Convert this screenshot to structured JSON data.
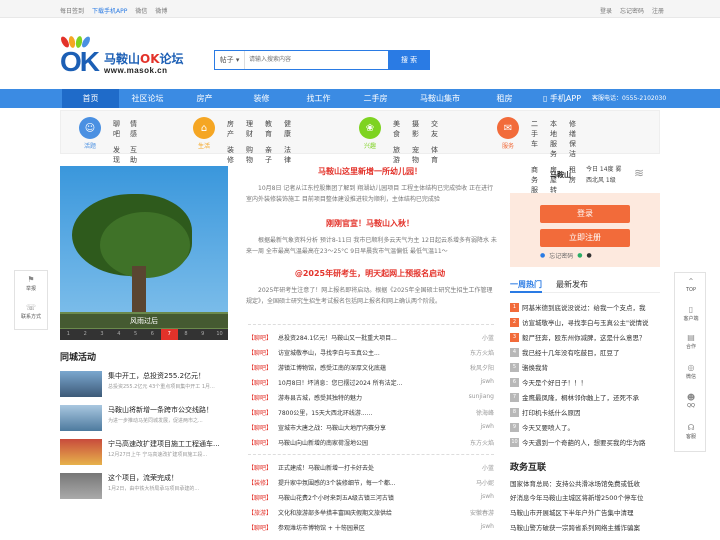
{
  "topbar": {
    "left": [
      "每日签到",
      "下载手机APP",
      "微信",
      "微博"
    ],
    "right": [
      "登录",
      "忘记密码",
      "注册"
    ]
  },
  "logo": {
    "ok": "OK",
    "cn": "马鞍山",
    "cn_hl": "OK",
    "cn2": "论坛",
    "url": "www.masok.cn"
  },
  "search": {
    "select": "帖子",
    "placeholder": "请输入搜索内容",
    "button": "搜 索"
  },
  "nav": {
    "items": [
      "首页",
      "社区论坛",
      "房产",
      "装修",
      "找工作",
      "二手房",
      "马鞍山集市",
      "租房",
      "手机APP"
    ],
    "phone": "客服电话：0555-2102030"
  },
  "cats": [
    {
      "title": "活题",
      "color": "#4a90e2",
      "links": [
        "聊吧",
        "情感",
        "发现",
        "互助"
      ]
    },
    {
      "title": "生活",
      "color": "#f5a623",
      "links": [
        "房产",
        "理财",
        "教育",
        "健康",
        "装修",
        "购物",
        "亲子",
        "法律"
      ]
    },
    {
      "title": "兴趣",
      "color": "#7ed321",
      "links": [
        "美食",
        "摄影",
        "交友",
        "旅游",
        "宠物",
        "体育"
      ]
    },
    {
      "title": "服务",
      "color": "#f26b3a",
      "links": [
        "二手车",
        "本地服务",
        "修缮保洁",
        "商务服务",
        "房屋转让",
        "租房"
      ]
    }
  ],
  "slide": {
    "caption": "风雨过后",
    "dots": [
      "1",
      "2",
      "3",
      "4",
      "5",
      "6",
      "7",
      "8",
      "9",
      "10"
    ],
    "active": 6
  },
  "activity": {
    "title": "同城活动",
    "items": [
      {
        "t": "集中开工，总投资255.2亿元！",
        "d": "总投资255.2亿元 43个重点项目集中开工 1月..."
      },
      {
        "t": "马鞍山将新增一条跨市公交线路！",
        "d": "为进一步推动马芜同城发展，促进两市之..."
      },
      {
        "t": "宁马高速改扩建项目施工工程通车...",
        "d": "12月27日上午 宁马高速改扩建项目施工段..."
      },
      {
        "t": "这个项目，流荣完成！",
        "d": "1月2日，由中铁大桥局承马项目承建的..."
      }
    ]
  },
  "headlines": [
    {
      "h": "马鞍山这里新增一所幼儿园！",
      "p": "10月8日 记者从江东控股集团了解到 翔湖幼儿园项目 工程主体结构已完成验收 正在进行室内外装修装饰施工 目前项目整体建设推进较为顺利，主体结构已完成验"
    },
    {
      "h": "刚刚官宣！马鞍山入秋！",
      "p": "根据最新气象资料分析 预计8-11日 我市已顺利多云天气为主 12日起云系增多有弱降水 未来一周 全市最高气温最高在23～25°C 9日早晨我市气温偏低 最低气温11～"
    },
    {
      "h": "@2025年研考生，明天起网上预报名启动",
      "p": "2025年研考生注意了！网上报名即将启动。根据《2025年全国硕士研究生招生工作管理规定》，全国硕士研究生招生考试报名包括网上报名和网上确认两个阶段。"
    }
  ],
  "list1": [
    {
      "tag": "【聊吧】",
      "t": "总投资284.1亿元！马鞍山又一批重大项目...",
      "a": "小蓝"
    },
    {
      "tag": "【聊吧】",
      "t": "访宣城敬亭山，寻找李白与玉真公主...",
      "a": "东方火焰"
    },
    {
      "tag": "【聊吧】",
      "t": "游镇江博物馆，感受江南的深厚文化底蕴",
      "a": "秋风夕阳"
    },
    {
      "tag": "【聊吧】",
      "t": "10月8日！坏消息：您已摆过2024 所有法定...",
      "a": "jswh"
    },
    {
      "tag": "【聊吧】",
      "t": "游寿县古城，感受其独特的魅力",
      "a": "sunjiang"
    },
    {
      "tag": "【聊吧】",
      "t": "7800公里，15天大西北环线游......",
      "a": "徐海峰"
    },
    {
      "tag": "【聊吧】",
      "t": "宣城市大唐之战：马鞍山大地厅内赛分享",
      "a": "jswh"
    },
    {
      "tag": "【聊吧】",
      "t": "马鞍山向山新增的南家荷湿地公园",
      "a": "东方火焰"
    }
  ],
  "list2": [
    {
      "tag": "【聊吧】",
      "t": "正式建成！马鞍山新增一打卡好去处",
      "a": "小蓝"
    },
    {
      "tag": "【装修】",
      "t": "提升家中氛围感的3个装修细节，每一个都...",
      "a": "马小妮"
    },
    {
      "tag": "【聊吧】",
      "t": "马鞍山花费2个小时来到五A级古镇三河古镇",
      "a": "jswh"
    },
    {
      "tag": "【旅游】",
      "t": "文化和旅游部多举措丰富国庆假期文旅供给",
      "a": "安徽春游"
    },
    {
      "tag": "【聊吧】",
      "t": "参观潍坊市博物馆 + 十笏园景区",
      "a": "jswh"
    }
  ],
  "weather": {
    "city": "马鞍山",
    "today": "今日 14度 雾",
    "wind": "西北风 1级"
  },
  "login": {
    "login": "登录",
    "register": "立即注册",
    "forgot": "忘记密码"
  },
  "tabs": {
    "a": "一周热门",
    "b": "最新发布"
  },
  "hot": [
    "阿基米德到底说没说过：给我一个支点，我",
    "访宣城敬亭山，寻找李白与玉真公主\"说情说",
    "毅尸狂奔，殴东州你减脾，这是什么意思？",
    "我已经十几年没有吃鼓目，肛豆了",
    "骆焕我背",
    "今天是个好日子！！！",
    "金鹰最凤隆，桐林邻你触上了，还死不承",
    "打印机卡纸什么原因",
    "今天又要喷人了。",
    "今天遇到一个奇葩的人，想要买我的华为路"
  ],
  "gov": {
    "title": "政务互联",
    "items": [
      "国家体育总局：支持公共滑冰场馆免费或低收",
      "好消息今年马鞍山主城区将新增2500个停车位",
      "马鞍山市开展城区下半年户外广告集中清理",
      "马鞍山警方破获一宗跨省系列网络主播诈骗案",
      "这场动员誓师大会，强心提气！"
    ]
  },
  "lfloat": [
    "举报",
    "联系方式"
  ],
  "rfloat": [
    "TOP",
    "客户端",
    "合作",
    "微信",
    "QQ",
    "客服"
  ]
}
